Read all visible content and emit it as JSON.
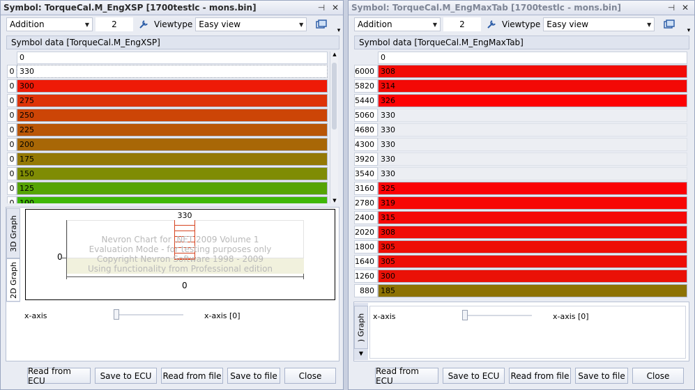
{
  "left": {
    "title": "Symbol: TorqueCal.M_EngXSP [1700testlc - mons.bin]",
    "operation": "Addition",
    "value": "2",
    "viewtype_label": "Viewtype",
    "viewtype": "Easy view",
    "symbol_data_label": "Symbol data [TorqueCal.M_EngXSP]",
    "column_header": "0",
    "rows": [
      {
        "h": "0",
        "v": "330",
        "color": "#ffffff"
      },
      {
        "h": "0",
        "v": "300",
        "color": "#ee1a07"
      },
      {
        "h": "0",
        "v": "275",
        "color": "#de3308"
      },
      {
        "h": "0",
        "v": "250",
        "color": "#cc4506"
      },
      {
        "h": "0",
        "v": "225",
        "color": "#b95607"
      },
      {
        "h": "0",
        "v": "200",
        "color": "#a86706"
      },
      {
        "h": "0",
        "v": "175",
        "color": "#947905"
      },
      {
        "h": "0",
        "v": "150",
        "color": "#7f8c04"
      },
      {
        "h": "0",
        "v": "125",
        "color": "#56a405"
      },
      {
        "h": "0",
        "v": "100",
        "color": "#3fb806"
      }
    ],
    "tabs": {
      "tab3d": "3D Graph",
      "tab2d": "2D Graph"
    },
    "chart": {
      "peak_label": "330",
      "y_tick": "0",
      "x_tick": "0",
      "watermark": [
        "Nevron Chart for .NET 2009 Volume 1",
        "Evaluation Mode - for testing purposes only",
        "Copyright Nevron Software 1998 - 2009",
        "Using functionality from Professional edition"
      ]
    },
    "slider_left": "x-axis",
    "slider_right": "x-axis [0]",
    "buttons": [
      "Read from ECU",
      "Save to ECU",
      "Read from file",
      "Save to file",
      "Close"
    ]
  },
  "right": {
    "title": "Symbol: TorqueCal.M_EngMaxTab [1700testlc - mons.bin]",
    "operation": "Addition",
    "value": "2",
    "viewtype_label": "Viewtype",
    "viewtype": "Easy view",
    "symbol_data_label": "Symbol data [TorqueCal.M_EngMaxTab]",
    "column_header": "0",
    "rows": [
      {
        "h": "6000",
        "v": "308",
        "color": "#f20c06"
      },
      {
        "h": "5820",
        "v": "314",
        "color": "#f30906"
      },
      {
        "h": "5440",
        "v": "326",
        "color": "#fd0204"
      },
      {
        "h": "5060",
        "v": "330",
        "color": "#eceef3"
      },
      {
        "h": "4680",
        "v": "330",
        "color": "#eceef3"
      },
      {
        "h": "4300",
        "v": "330",
        "color": "#eceef3"
      },
      {
        "h": "3920",
        "v": "330",
        "color": "#eceef3"
      },
      {
        "h": "3540",
        "v": "330",
        "color": "#eceef3"
      },
      {
        "h": "3160",
        "v": "325",
        "color": "#fa0205"
      },
      {
        "h": "2780",
        "v": "319",
        "color": "#f70705"
      },
      {
        "h": "2400",
        "v": "315",
        "color": "#f50806"
      },
      {
        "h": "2020",
        "v": "308",
        "color": "#f00c06"
      },
      {
        "h": "1800",
        "v": "305",
        "color": "#ee0e06"
      },
      {
        "h": "1640",
        "v": "305",
        "color": "#ee0e06"
      },
      {
        "h": "1260",
        "v": "300",
        "color": "#ea1107"
      },
      {
        "h": "880",
        "v": "185",
        "color": "#8d7203"
      }
    ],
    "tab_label": ") Graph",
    "slider_left": "x-axis",
    "slider_right": "x-axis [0]",
    "buttons": [
      "Read from ECU",
      "Save to ECU",
      "Read from file",
      "Save to file",
      "Close"
    ]
  },
  "icons": {
    "pin": "pin-icon",
    "close": "close-icon",
    "tool": "wrench-icon",
    "view": "window-icon"
  }
}
